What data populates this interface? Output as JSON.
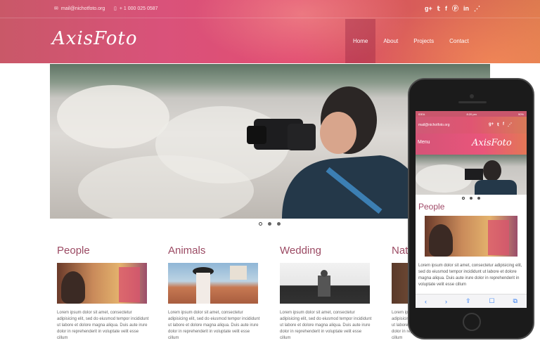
{
  "topbar": {
    "email": "mail@nichotfoto.org",
    "phone": "+ 1 000 025 0587",
    "socials": [
      "g+",
      "t",
      "f",
      "p",
      "in",
      "rss"
    ]
  },
  "brand": {
    "logo": "AxisFoto"
  },
  "nav": [
    {
      "label": "Home",
      "active": true
    },
    {
      "label": "About"
    },
    {
      "label": "Projects"
    },
    {
      "label": "Contact"
    }
  ],
  "slider": {
    "dots": 3,
    "active": 0
  },
  "sections": [
    {
      "title": "People",
      "text": "Lorem ipsum dolor sit amet, consectetur adipisicing elit, sed do eiusmod tempor incididunt ut labore et dolore magna aliqua. Duis aute irure dolor in reprehenderit in voluptate velit esse cillum"
    },
    {
      "title": "Animals",
      "text": "Lorem ipsum dolor sit amet, consectetur adipisicing elit, sed do eiusmod tempor incididunt ut labore et dolore magna aliqua. Duis aute irure dolor in reprehenderit in voluptate velit esse cillum"
    },
    {
      "title": "Wedding",
      "text": "Lorem ipsum dolor sit amet, consectetur adipisicing elit, sed do eiusmod tempor incididunt ut labore et dolore magna aliqua. Duis aute irure dolor in reprehenderit in voluptate velit esse cillum"
    },
    {
      "title": "Nat",
      "text": "Lorem ipsum dolor sit amet, consectetur adipisicing elit, sed do eiusmod tempor incididunt ut labore et dolore magna aliqua. Duis aute irure dolor in reprehenderit in voluptate velit esse cillum"
    }
  ],
  "phone": {
    "status_left": "IDEA",
    "status_time": "8:20 pm",
    "status_right": "90%",
    "email": "mail@nichotfoto.org",
    "menu": "Menu",
    "logo": "AxisFoto",
    "section_title": "People",
    "text": "Lorem ipsum dolor sit amet, consectetur adipisicing elit, sed do eiusmod tempor incididunt ut labore et dolore magna aliqua. Duis aute irure dolor in reprehenderit in voluptate velit esse cillum",
    "toolbar": [
      "‹",
      "›",
      "⇪",
      "☐",
      "⧉"
    ]
  },
  "colors": {
    "accent": "#9b4a63",
    "header": "#e24d72"
  }
}
